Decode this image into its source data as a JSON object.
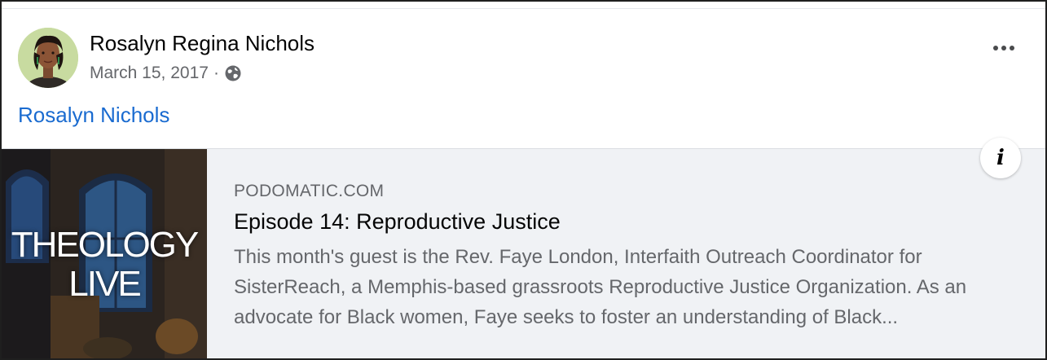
{
  "post": {
    "author": "Rosalyn Regina Nichols",
    "date": "March 15, 2017",
    "separator": "·",
    "audience_icon": "globe-icon",
    "more_icon": "more-options-icon",
    "text": "Rosalyn Nichols"
  },
  "link_card": {
    "domain": "PODOMATIC.COM",
    "title": "Episode 14: Reproductive Justice",
    "description": "This month's guest is the Rev. Faye London, Interfaith Outreach Coordinator for SisterReach, a Memphis-based grassroots Reproductive Justice Organization. As an advocate for Black women, Faye seeks to foster an understanding of Black...",
    "thumbnail_text_line1": "THEOLOGY",
    "thumbnail_text_line2": "LIVE",
    "info_label": "i"
  },
  "colors": {
    "link_blue": "#1a6bd0",
    "card_bg": "#f0f2f5",
    "secondary_text": "#65676b"
  }
}
